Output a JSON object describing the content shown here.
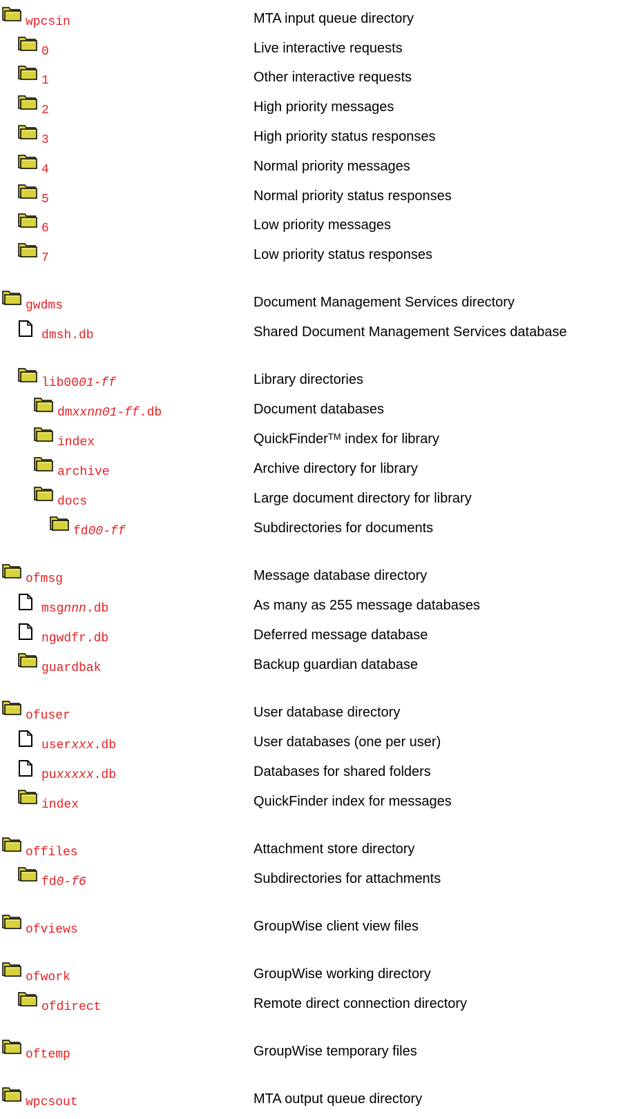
{
  "colors": {
    "filename": "#e81f23",
    "folder_fill": "#d8d23c",
    "text": "#000000"
  },
  "rows": [
    {
      "icon": "folder-icon",
      "name": [
        {
          "t": "wpcsin"
        }
      ],
      "desc": [
        {
          "t": "MTA input queue directory"
        }
      ]
    },
    {
      "icon": "folder-icon",
      "name": [
        {
          "t": "0"
        }
      ],
      "desc": [
        {
          "t": "Live interactive requests"
        }
      ]
    },
    {
      "icon": "folder-icon",
      "name": [
        {
          "t": "1"
        }
      ],
      "desc": [
        {
          "t": "Other interactive requests"
        }
      ]
    },
    {
      "icon": "folder-icon",
      "name": [
        {
          "t": "2"
        }
      ],
      "desc": [
        {
          "t": "High priority messages"
        }
      ]
    },
    {
      "icon": "folder-icon",
      "name": [
        {
          "t": "3"
        }
      ],
      "desc": [
        {
          "t": "High priority status responses"
        }
      ]
    },
    {
      "icon": "folder-icon",
      "name": [
        {
          "t": "4"
        }
      ],
      "desc": [
        {
          "t": "Normal priority messages"
        }
      ]
    },
    {
      "icon": "folder-icon",
      "name": [
        {
          "t": "5"
        }
      ],
      "desc": [
        {
          "t": "Normal priority status responses"
        }
      ]
    },
    {
      "icon": "folder-icon",
      "name": [
        {
          "t": "6"
        }
      ],
      "desc": [
        {
          "t": "Low priority messages"
        }
      ]
    },
    {
      "icon": "folder-icon",
      "name": [
        {
          "t": "7"
        }
      ],
      "desc": [
        {
          "t": "Low priority status responses"
        }
      ]
    },
    {
      "icon": "folder-icon",
      "name": [
        {
          "t": "gwdms"
        }
      ],
      "desc": [
        {
          "t": "Document Management Services directory"
        }
      ]
    },
    {
      "icon": "file-icon",
      "name": [
        {
          "t": "dmsh.db"
        }
      ],
      "desc": [
        {
          "t": "Shared Document Management Services database"
        }
      ]
    },
    {
      "icon": "folder-icon",
      "name": [
        {
          "t": "lib00"
        },
        {
          "t": "01-ff",
          "i": true
        }
      ],
      "desc": [
        {
          "t": "Library directories"
        }
      ]
    },
    {
      "icon": "folder-icon",
      "name": [
        {
          "t": "dm"
        },
        {
          "t": "xxnn01-ff",
          "i": true
        },
        {
          "t": ".db"
        }
      ],
      "desc": [
        {
          "t": "Document databases"
        }
      ]
    },
    {
      "icon": "folder-icon",
      "name": [
        {
          "t": "index"
        }
      ],
      "desc": [
        {
          "t": "QuickFinder"
        },
        {
          "t": "TM",
          "sup": true
        },
        {
          "t": " index for library"
        }
      ]
    },
    {
      "icon": "folder-icon",
      "name": [
        {
          "t": "archive"
        }
      ],
      "desc": [
        {
          "t": "Archive directory for library"
        }
      ]
    },
    {
      "icon": "folder-icon",
      "name": [
        {
          "t": "docs"
        }
      ],
      "desc": [
        {
          "t": "Large document directory for library"
        }
      ]
    },
    {
      "icon": "folder-icon",
      "name": [
        {
          "t": "fd"
        },
        {
          "t": "00-ff",
          "i": true
        }
      ],
      "desc": [
        {
          "t": "Subdirectories for documents"
        }
      ]
    },
    {
      "icon": "folder-icon",
      "name": [
        {
          "t": "ofmsg"
        }
      ],
      "desc": [
        {
          "t": "Message database directory"
        }
      ]
    },
    {
      "icon": "file-icon",
      "name": [
        {
          "t": "msg"
        },
        {
          "t": "nnn",
          "i": true
        },
        {
          "t": ".db"
        }
      ],
      "desc": [
        {
          "t": "As many as 255 message databases"
        }
      ]
    },
    {
      "icon": "file-icon",
      "name": [
        {
          "t": "ngwdfr.db"
        }
      ],
      "desc": [
        {
          "t": "Deferred message database"
        }
      ]
    },
    {
      "icon": "folder-icon",
      "name": [
        {
          "t": "guardbak"
        }
      ],
      "desc": [
        {
          "t": "Backup guardian database"
        }
      ]
    },
    {
      "icon": "folder-icon",
      "name": [
        {
          "t": "ofuser"
        }
      ],
      "desc": [
        {
          "t": "User database directory"
        }
      ]
    },
    {
      "icon": "file-icon",
      "name": [
        {
          "t": "user"
        },
        {
          "t": "xxx",
          "i": true
        },
        {
          "t": ".db"
        }
      ],
      "desc": [
        {
          "t": "User databases (one per user)"
        }
      ]
    },
    {
      "icon": "file-icon",
      "name": [
        {
          "t": "pu"
        },
        {
          "t": "xxxxx",
          "i": true
        },
        {
          "t": ".db"
        }
      ],
      "desc": [
        {
          "t": "Databases for shared folders"
        }
      ]
    },
    {
      "icon": "folder-icon",
      "name": [
        {
          "t": "index"
        }
      ],
      "desc": [
        {
          "t": "QuickFinder index for messages"
        }
      ]
    },
    {
      "icon": "folder-icon",
      "name": [
        {
          "t": "offiles"
        }
      ],
      "desc": [
        {
          "t": "Attachment store directory"
        }
      ]
    },
    {
      "icon": "folder-icon",
      "name": [
        {
          "t": "fd"
        },
        {
          "t": "0-f6",
          "i": true
        }
      ],
      "desc": [
        {
          "t": "Subdirectories for attachments"
        }
      ]
    },
    {
      "icon": "folder-icon",
      "name": [
        {
          "t": "ofviews"
        }
      ],
      "desc": [
        {
          "t": "GroupWise client view files"
        }
      ]
    },
    {
      "icon": "folder-icon",
      "name": [
        {
          "t": "ofwork"
        }
      ],
      "desc": [
        {
          "t": "GroupWise working directory"
        }
      ]
    },
    {
      "icon": "folder-icon",
      "name": [
        {
          "t": "ofdirect"
        }
      ],
      "desc": [
        {
          "t": "Remote direct connection directory"
        }
      ]
    },
    {
      "icon": "folder-icon",
      "name": [
        {
          "t": "oftemp"
        }
      ],
      "desc": [
        {
          "t": "GroupWise temporary files"
        }
      ]
    },
    {
      "icon": "folder-icon",
      "name": [
        {
          "t": "wpcsout"
        }
      ],
      "desc": [
        {
          "t": "MTA output queue directory"
        }
      ]
    }
  ]
}
